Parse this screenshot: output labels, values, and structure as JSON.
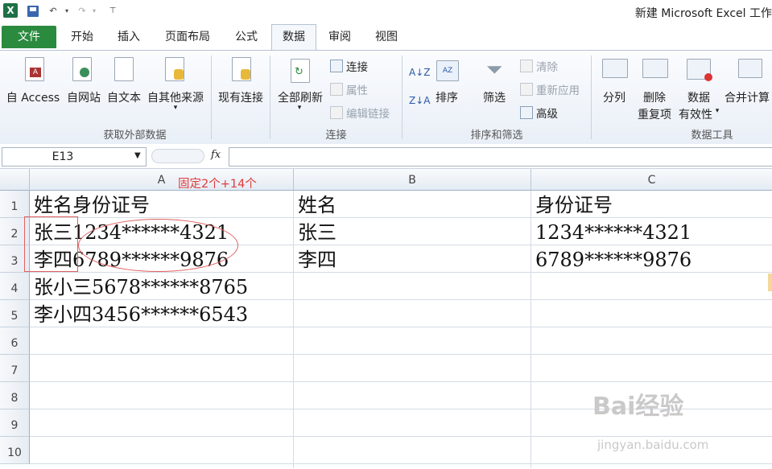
{
  "window": {
    "title": "新建 Microsoft Excel 工作"
  },
  "tabs": [
    "文件",
    "开始",
    "插入",
    "页面布局",
    "公式",
    "数据",
    "审阅",
    "视图"
  ],
  "ribbon": {
    "get_external": {
      "label": "获取外部数据",
      "buttons": [
        "自 Access",
        "自网站",
        "自文本",
        "自其他来源",
        "现有连接"
      ]
    },
    "connections": {
      "label": "连接",
      "refresh_all": "全部刷新",
      "items": [
        "连接",
        "属性",
        "编辑链接"
      ]
    },
    "sort_filter": {
      "label": "排序和筛选",
      "sort": "排序",
      "filter": "筛选",
      "items": [
        "清除",
        "重新应用",
        "高级"
      ]
    },
    "data_tools": {
      "label": "数据工具",
      "split": "分列",
      "remove_dup": [
        "删除",
        "重复项"
      ],
      "validation": [
        "数据",
        "有效性"
      ],
      "consolidate": "合并计算"
    }
  },
  "formula_bar": {
    "name_box": "E13",
    "fx": "fx",
    "value": ""
  },
  "columns": [
    "A",
    "B",
    "C"
  ],
  "rows": [
    "1",
    "2",
    "3",
    "4",
    "5",
    "6",
    "7",
    "8",
    "9",
    "10"
  ],
  "cells": {
    "A1": "姓名身份证号",
    "B1": "姓名",
    "C1": "身份证号",
    "A2": "张三1234******4321",
    "B2": "张三",
    "C2": "1234******4321",
    "A3": "李四6789******9876",
    "B3": "李四",
    "C3": "6789******9876",
    "A4": "张小三5678******8765",
    "A5": "李小四3456******6543"
  },
  "annotation": "固定2个+14个",
  "watermark": {
    "brand": "Bai经验",
    "url": "jingyan.baidu.com"
  }
}
